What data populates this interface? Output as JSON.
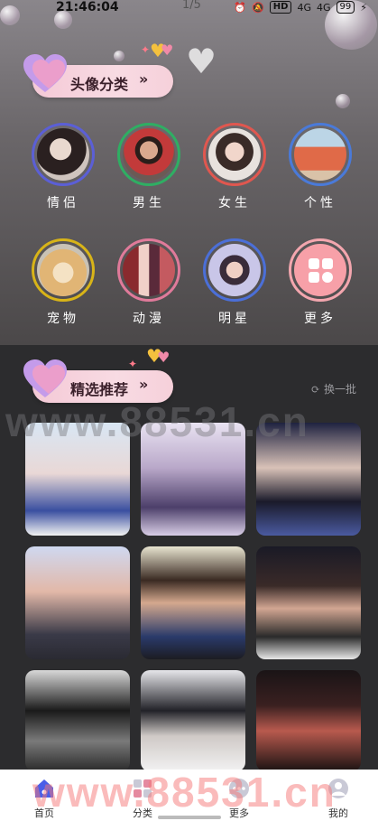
{
  "status_bar": {
    "time": "21:46:04",
    "page": "1/5",
    "hd": "HD",
    "signal_1": "4G",
    "signal_2": "4G",
    "battery": "99"
  },
  "category_section": {
    "title": "头像分类",
    "chevron": "»"
  },
  "categories": [
    {
      "label": "情侣",
      "ring_color": "#5b5fd6"
    },
    {
      "label": "男生",
      "ring_color": "#2fae63"
    },
    {
      "label": "女生",
      "ring_color": "#e0574f"
    },
    {
      "label": "个性",
      "ring_color": "#4a7ad9"
    },
    {
      "label": "宠物",
      "ring_color": "#d8b418"
    },
    {
      "label": "动漫",
      "ring_color": "#e07a9a"
    },
    {
      "label": "明星",
      "ring_color": "#4b6fd8"
    },
    {
      "label": "更多",
      "ring_color": "#f3a6ae"
    }
  ],
  "featured_section": {
    "title": "精选推荐",
    "chevron": "»",
    "refresh_label": "换一批"
  },
  "watermark": "www.88531.cn",
  "watermark_bottom": "www.88531.cn",
  "bottom_nav": [
    {
      "label": "首页",
      "icon": "home-icon",
      "active": true
    },
    {
      "label": "分类",
      "icon": "category-icon",
      "active": false
    },
    {
      "label": "更多",
      "icon": "more-icon",
      "active": false
    },
    {
      "label": "我的",
      "icon": "profile-icon",
      "active": false
    }
  ],
  "colors": {
    "accent": "#f4c9d6",
    "active_nav": "#4a5ee8"
  }
}
